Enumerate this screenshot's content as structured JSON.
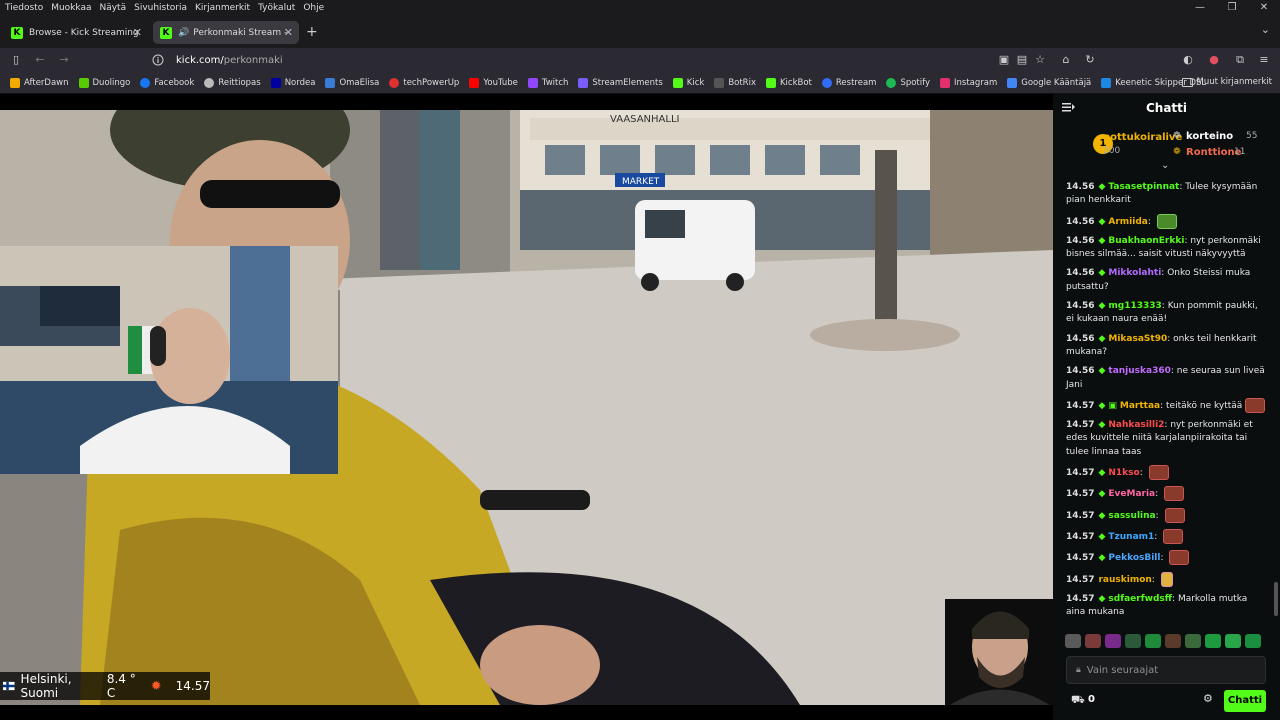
{
  "menubar": {
    "items": [
      "Tiedosto",
      "Muokkaa",
      "Näytä",
      "Sivuhistoria",
      "Kirjanmerkit",
      "Työkalut",
      "Ohje"
    ]
  },
  "tabs": [
    {
      "title": "Browse - Kick Streaming",
      "active": false
    },
    {
      "title": "Perkonmaki Stream - Watch",
      "active": true
    }
  ],
  "nav": {
    "url_host": "kick.com/",
    "url_path": "perkonmaki"
  },
  "bookmarks": [
    {
      "label": "AfterDawn",
      "color": "#f2a900"
    },
    {
      "label": "Duolingo",
      "color": "#58cc02"
    },
    {
      "label": "Facebook",
      "color": "#1877f2"
    },
    {
      "label": "Reittiopas",
      "color": "#bbbbbb"
    },
    {
      "label": "Nordea",
      "color": "#0000a0"
    },
    {
      "label": "OmaElisa",
      "color": "#3a7bd5"
    },
    {
      "label": "techPowerUp",
      "color": "#e03030"
    },
    {
      "label": "YouTube",
      "color": "#ff0000"
    },
    {
      "label": "Twitch",
      "color": "#9146ff"
    },
    {
      "label": "StreamElements",
      "color": "#7a5cff"
    },
    {
      "label": "Kick",
      "color": "#53fc18"
    },
    {
      "label": "BotRix",
      "color": "#555555"
    },
    {
      "label": "KickBot",
      "color": "#53fc18"
    },
    {
      "label": "Restream",
      "color": "#2f6df6"
    },
    {
      "label": "Spotify",
      "color": "#1db954"
    },
    {
      "label": "Instagram",
      "color": "#e1306c"
    },
    {
      "label": "Google Kääntäjä",
      "color": "#4285f4"
    },
    {
      "label": "Keenetic Skipper DSL",
      "color": "#1e88e5"
    }
  ],
  "other_bookmarks": "Muut kirjanmerkit",
  "video": {
    "location": "Helsinki, Suomi",
    "temperature": "8.4 ° C",
    "time": "14.57",
    "shop_sign": "VAASANHALLI",
    "market_sign": "MARKET"
  },
  "chat": {
    "title": "Chatti",
    "leaders": [
      {
        "rank": "1",
        "name": "pottukoiralive",
        "amount": "200"
      },
      {
        "name": "korteino",
        "amount": "55"
      },
      {
        "name": "Ronttione",
        "amount": "11"
      }
    ],
    "messages": [
      {
        "time": "14.56",
        "user": "Tasasetpinnat",
        "color": "#53fc18",
        "text": "Tulee kysymään pian henkkarit",
        "emote": false
      },
      {
        "time": "14.56",
        "user": "Armiida",
        "color": "#f0b400",
        "text": "",
        "emote": true
      },
      {
        "time": "14.56",
        "user": "BuakhaonErkki",
        "color": "#53fc18",
        "text": "nyt perkonmäki bisnes silmää... saisit vitusti näkyvyyttä",
        "emote": false
      },
      {
        "time": "14.56",
        "user": "Mikkolahti",
        "color": "#b36cff",
        "text": "Onko Steissi muka putsattu?",
        "emote": false
      },
      {
        "time": "14.56",
        "user": "mg113333",
        "color": "#53fc18",
        "text": "Kun pommit paukki, ei kukaan naura enää!",
        "emote": false
      },
      {
        "time": "14.56",
        "user": "MikasaSt90",
        "color": "#f0b400",
        "text": "onks teil henkkarit mukana?",
        "emote": false
      },
      {
        "time": "14.56",
        "user": "tanjuska360",
        "color": "#c06cff",
        "text": "ne seuraa sun liveä Jani",
        "emote": false
      },
      {
        "time": "14.57",
        "user": "Marttaa",
        "color": "#f0b400",
        "text": "teitäkö ne kyttää",
        "emote": true
      },
      {
        "time": "14.57",
        "user": "Nahkasilli2",
        "color": "#ff4d4d",
        "text": "nyt perkonmäki et edes kuvittele niitä karjalanpiirakoita tai tulee linnaa taas",
        "emote": false
      },
      {
        "time": "14.57",
        "user": "N1kso",
        "color": "#ff4d4d",
        "text": "",
        "emote": true
      },
      {
        "time": "14.57",
        "user": "EveMaria",
        "color": "#ff66a3",
        "text": "",
        "emote": true
      },
      {
        "time": "14.57",
        "user": "sassulina",
        "color": "#53fc18",
        "text": "",
        "emote": true
      },
      {
        "time": "14.57",
        "user": "Tzunam1",
        "color": "#3fa7ff",
        "text": "",
        "emote": true
      },
      {
        "time": "14.57",
        "user": "PekkosBill",
        "color": "#4da6ff",
        "text": "",
        "emote": true
      },
      {
        "time": "14.57",
        "user": "rauskimon",
        "color": "#f0b400",
        "text": "",
        "emote": true
      },
      {
        "time": "14.57",
        "user": "sdfaerfwdsff",
        "color": "#53fc18",
        "text": "Markolla mutka aina mukana",
        "emote": false
      }
    ],
    "input_placeholder": "Vain seuraajat",
    "viewers_count": "0",
    "send_label": "Chatti"
  }
}
